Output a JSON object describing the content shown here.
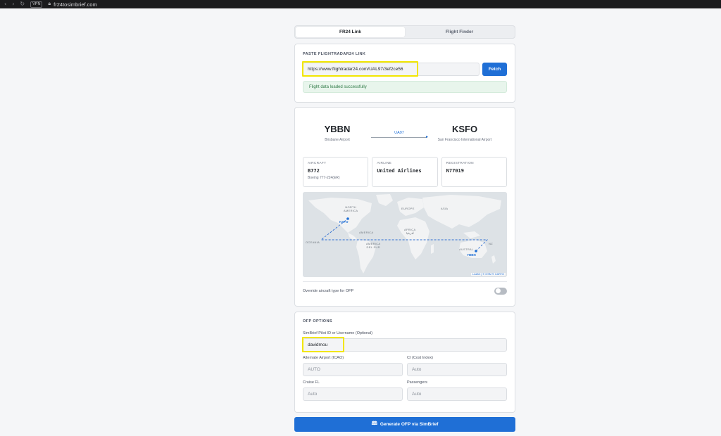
{
  "browser": {
    "vpn_label": "VPN",
    "url": "fr24tosimbrief.com"
  },
  "tabs": [
    {
      "label": "FR24 Link",
      "active": true
    },
    {
      "label": "Flight Finder",
      "active": false
    }
  ],
  "paste": {
    "label": "PASTE FLIGHTRADAR24 LINK",
    "url_value": "https://www.flightradar24.com/UAL97/3ef2ce56",
    "fetch_label": "Fetch",
    "success_message": "Flight data loaded successfully"
  },
  "flight": {
    "origin": {
      "code": "YBBN",
      "name": "Brisbane Airport"
    },
    "destination": {
      "code": "KSFO",
      "name": "San Francisco International Airport"
    },
    "flight_number": "UA97",
    "aircraft": {
      "label": "AIRCRAFT",
      "value": "B772",
      "sub": "Boeing 777-224(ER)"
    },
    "airline": {
      "label": "AIRLINE",
      "value": "United Airlines"
    },
    "registration": {
      "label": "REGISTRATION",
      "value": "N77019"
    },
    "map": {
      "labels": {
        "north_america": "NORTH\nAMERICA",
        "europe": "EUROPE",
        "asia": "ASIA",
        "africa": "AFRICA\nأفريقيا",
        "south_america": "AMERICA\nDEL SUR",
        "america_short": "AMERICA",
        "oceania": "OCEANIA",
        "australia": "AUSTRAL",
        "nz": "NZ"
      },
      "origin_marker": "YBBN",
      "destination_marker": "KSFO",
      "attribution": "Leaflet | © OSM © CARTO"
    },
    "override_label": "Override aircraft type for OFP"
  },
  "ofp": {
    "title": "OFP OPTIONS",
    "pilot_label": "SimBrief Pilot ID or Username (Optional)",
    "pilot_value": "davidmou",
    "alt_label": "Alternate Airport (ICAO)",
    "alt_placeholder": "AUTO",
    "ci_label": "CI (Cost Index)",
    "ci_placeholder": "Auto",
    "cruise_label": "Cruise FL",
    "cruise_placeholder": "Auto",
    "pax_label": "Passengers",
    "pax_placeholder": "Auto"
  },
  "generate_label": "Generate OFP via SimBrief",
  "colors": {
    "accent": "#1f6fd6",
    "highlight": "#f2e600",
    "success_bg": "#e8f5ec"
  }
}
